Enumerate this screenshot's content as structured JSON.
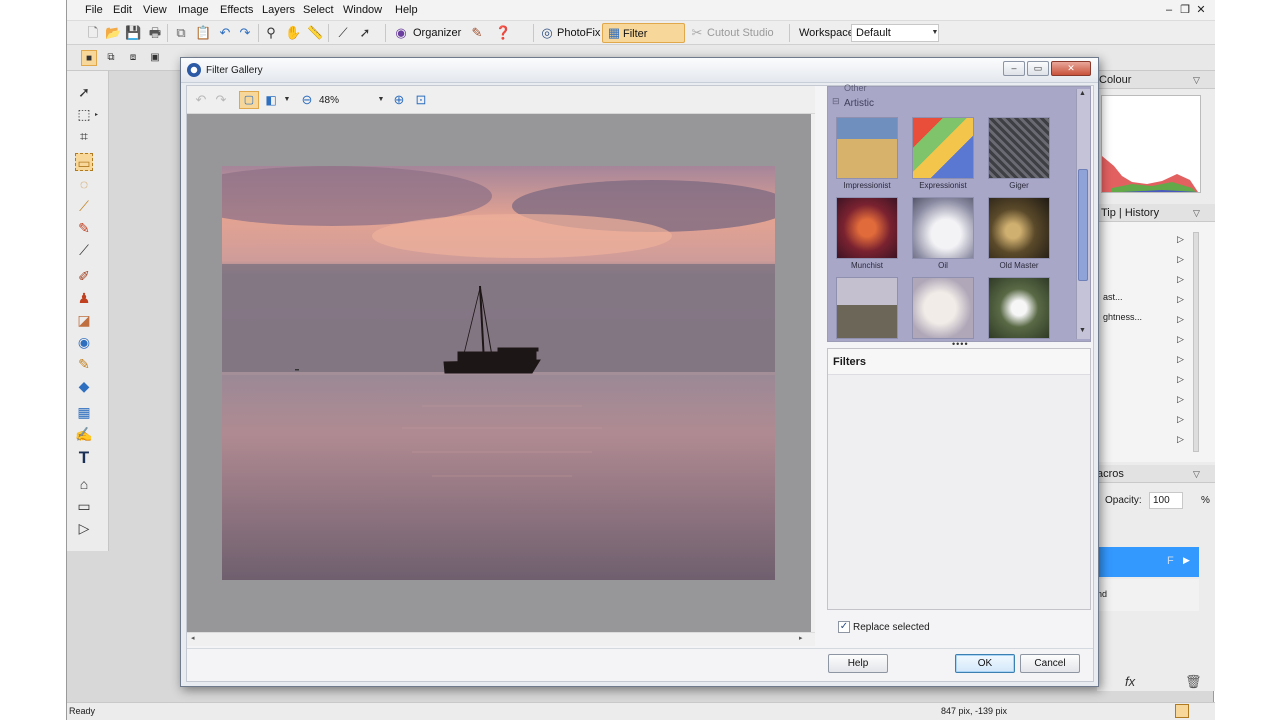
{
  "menubar": {
    "items": [
      "File",
      "Edit",
      "View",
      "Image",
      "Effects",
      "Layers",
      "Select",
      "Window",
      "Help"
    ]
  },
  "toolbar": {
    "organizer_label": "Organizer",
    "photofix_label": "PhotoFix",
    "filter_gallery_label": "Filter Gallery",
    "cutout_studio_label": "Cutout Studio",
    "workspace_label": "Workspace",
    "workspace_value": "Default"
  },
  "right_panels": {
    "colour_tab": "Colour",
    "tip_history_tabs": "Tip | History",
    "macro_items": [
      "ast...",
      "ghtness..."
    ],
    "macros_tab": "acros",
    "opacity_label": "Opacity:",
    "opacity_value": "100",
    "opacity_unit": "%",
    "layer_blend_label": "nd",
    "layer_f_label": "F"
  },
  "statusbar": {
    "left_text": "Ready",
    "coords_text": "847 pix, -139 pix"
  },
  "dialog": {
    "title": "Filter Gallery",
    "zoom_value": "48%",
    "gallery": {
      "category_partial": "Other",
      "category": "Artistic",
      "thumbs": [
        {
          "label": "Impressionist",
          "color": "#c9a05c"
        },
        {
          "label": "Expressionist",
          "color": "#d14b3a"
        },
        {
          "label": "Giger",
          "color": "#4a4a50"
        },
        {
          "label": "Munchist",
          "color": "#8e2a2a"
        },
        {
          "label": "Oil",
          "color": "#c9c9d6"
        },
        {
          "label": "Old Master",
          "color": "#3b3020"
        },
        {
          "label": "",
          "color": "#7a7a66"
        },
        {
          "label": "",
          "color": "#cfc9c4"
        },
        {
          "label": "",
          "color": "#4e5a3e"
        }
      ]
    },
    "filters_header": "Filters",
    "replace_selected_label": "Replace selected",
    "help_button": "Help",
    "ok_button": "OK",
    "cancel_button": "Cancel"
  }
}
